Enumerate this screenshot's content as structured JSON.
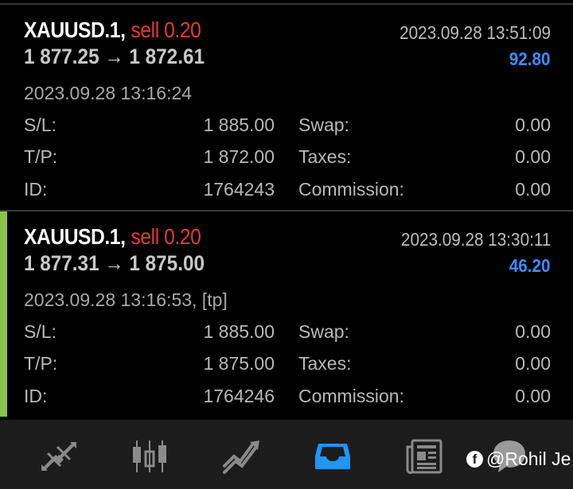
{
  "deals": [
    {
      "symbol": "XAUUSD.1",
      "separator": ",",
      "side": "sell 0.20",
      "close_time": "2023.09.28 13:51:09",
      "prices": "1 877.25 → 1 872.61",
      "profit": "92.80",
      "open_time": "2023.09.28 13:16:24",
      "sl_label": "S/L:",
      "sl": "1 885.00",
      "tp_label": "T/P:",
      "tp": "1 872.00",
      "id_label": "ID:",
      "id": "1764243",
      "swap_label": "Swap:",
      "swap": "0.00",
      "taxes_label": "Taxes:",
      "taxes": "0.00",
      "commission_label": "Commission:",
      "commission": "0.00"
    },
    {
      "symbol": "XAUUSD.1",
      "separator": ",",
      "side": "sell 0.20",
      "close_time": "2023.09.28 13:30:11",
      "prices": "1 877.31 → 1 875.00",
      "profit": "46.20",
      "open_time": "2023.09.28 13:16:53, [tp]",
      "sl_label": "S/L:",
      "sl": "1 885.00",
      "tp_label": "T/P:",
      "tp": "1 875.00",
      "id_label": "ID:",
      "id": "1764246",
      "swap_label": "Swap:",
      "swap": "0.00",
      "taxes_label": "Taxes:",
      "taxes": "0.00",
      "commission_label": "Commission:",
      "commission": "0.00"
    }
  ],
  "colors": {
    "sell": "#e53935",
    "profit": "#3d8bfd",
    "selected_accent": "#8bc34a",
    "active_nav": "#2196f3",
    "inactive_nav": "#8a8a8a"
  },
  "navbar": {
    "items": [
      {
        "icon": "quotes-arrows-icon",
        "active": false
      },
      {
        "icon": "candlestick-chart-icon",
        "active": false
      },
      {
        "icon": "trade-chart-icon",
        "active": false
      },
      {
        "icon": "history-inbox-icon",
        "active": true
      },
      {
        "icon": "news-icon",
        "active": false
      },
      {
        "icon": "chat-icon",
        "active": false
      }
    ]
  },
  "watermark": {
    "icon": "facebook-icon",
    "text": "@Rohil Je"
  }
}
